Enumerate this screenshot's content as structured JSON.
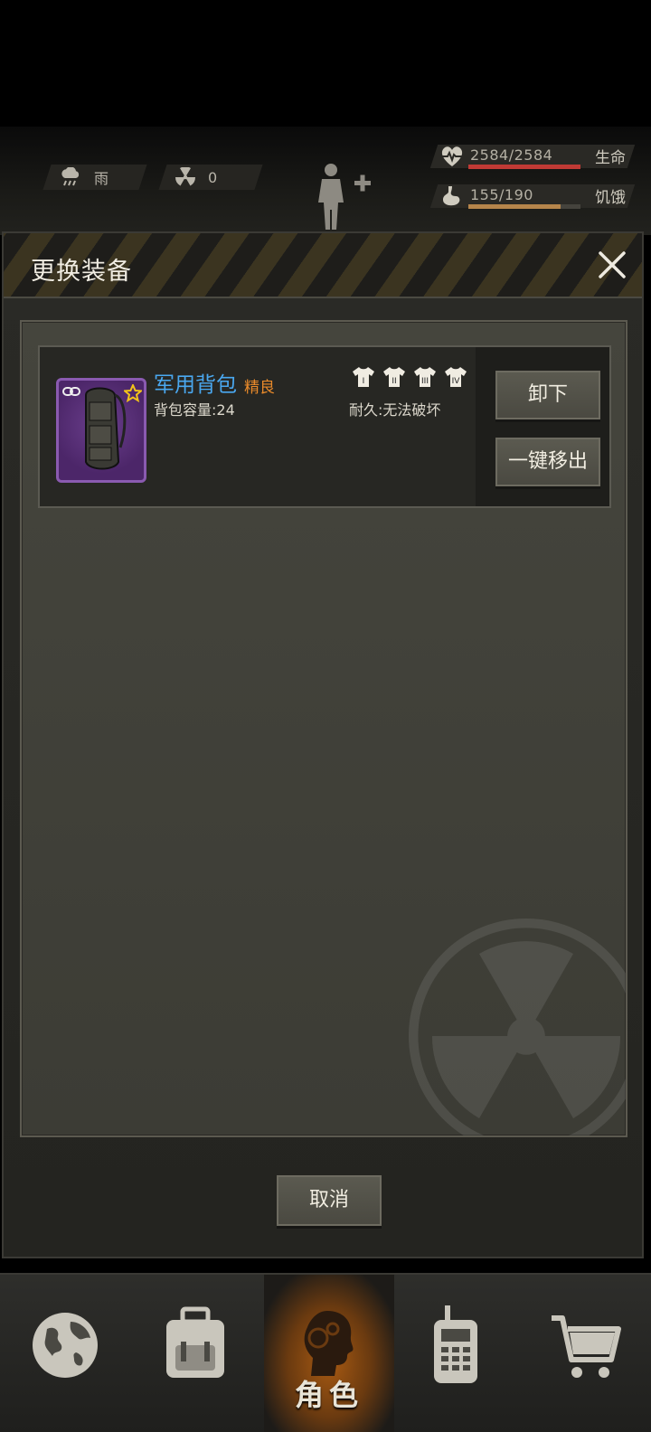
{
  "hud": {
    "weather": "雨",
    "radiation": "0",
    "health": {
      "value": "2584/2584",
      "label": "生命",
      "fraction": 1.0
    },
    "hunger": {
      "value": "155/190",
      "label": "饥饿",
      "fraction": 0.82
    }
  },
  "dialog": {
    "title": "更换装备",
    "cancel_label": "取消"
  },
  "item": {
    "name": "军用背包",
    "quality": "精良",
    "capacity": "背包容量:24",
    "durability": "耐久:无法破坏",
    "slots": [
      "I",
      "II",
      "III",
      "IV"
    ],
    "unequip_label": "卸下",
    "move_out_label": "一键移出"
  },
  "nav": {
    "items": [
      {
        "icon": "globe-icon"
      },
      {
        "icon": "backpack-icon"
      },
      {
        "icon": "character-icon",
        "label": "角色",
        "active": true
      },
      {
        "icon": "radio-icon"
      },
      {
        "icon": "cart-icon"
      }
    ]
  },
  "colors": {
    "item_name": "#4aa8f0",
    "quality": "#e98a2a",
    "health_bar": "#c03a35",
    "hunger_bar": "#b6854b",
    "item_frame": "#8a5ab0"
  }
}
